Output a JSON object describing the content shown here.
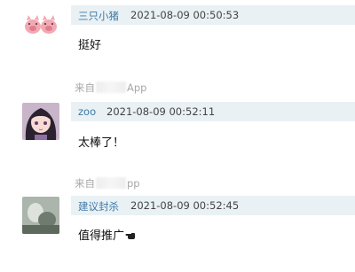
{
  "comments": [
    {
      "username": "三只小猪",
      "timestamp": "2021-08-09 00:50:53",
      "content": "挺好",
      "source": {
        "prefix": "来自",
        "suffix": "App"
      }
    },
    {
      "username": "zoo",
      "timestamp": "2021-08-09 00:52:11",
      "content": "太棒了！",
      "source": {
        "prefix": "来自",
        "suffix": "pp"
      }
    },
    {
      "username": "建议封杀",
      "timestamp": "2021-08-09 00:52:45",
      "content": "值得推广",
      "emoji_icon": "pointing-hand-icon"
    }
  ],
  "colors": {
    "meta_bar": "#e9f1f4",
    "username": "#3f79a8",
    "source_text": "#a7a7a7"
  }
}
